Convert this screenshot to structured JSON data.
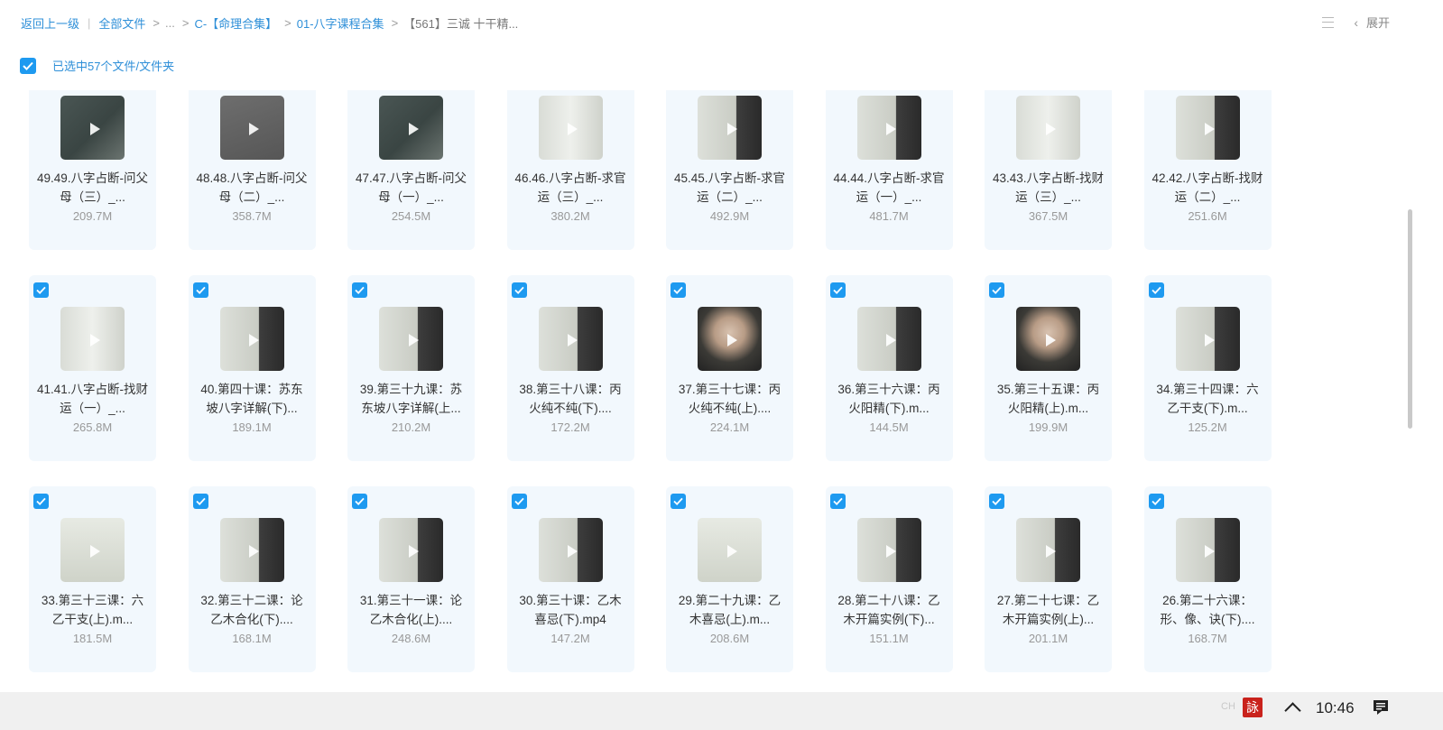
{
  "breadcrumb": {
    "back": "返回上一级",
    "root": "全部文件",
    "ellipsis": "...",
    "level1": "C-【命理合集】",
    "level2": "01-八字课程合集",
    "current": "【561】三诚 十干精..."
  },
  "toolbar": {
    "expand_label": "展开",
    "view_icon": "list-view-icon",
    "collapse_icon": "chevron-left-icon"
  },
  "selection": {
    "label": "已选中57个文件/文件夹",
    "checked": true
  },
  "files": [
    {
      "name": "49.49.八字占断-问父母（三）_...",
      "size": "209.7M",
      "thumb": "chalkboard-hand"
    },
    {
      "name": "48.48.八字占断-问父母（二）_...",
      "size": "358.7M",
      "thumb": "gray"
    },
    {
      "name": "47.47.八字占断-问父母（一）_...",
      "size": "254.5M",
      "thumb": "chalkboard-hand"
    },
    {
      "name": "46.46.八字占断-求官运（三）_...",
      "size": "380.2M",
      "thumb": "whiteboard-grid"
    },
    {
      "name": "45.45.八字占断-求官运（二）_...",
      "size": "492.9M",
      "thumb": "whiteboard-man"
    },
    {
      "name": "44.44.八字占断-求官运（一）_...",
      "size": "481.7M",
      "thumb": "whiteboard-man"
    },
    {
      "name": "43.43.八字占断-找财运（三）_...",
      "size": "367.5M",
      "thumb": "whiteboard-grid"
    },
    {
      "name": "42.42.八字占断-找财运（二）_...",
      "size": "251.6M",
      "thumb": "whiteboard-man"
    },
    {
      "name": "41.41.八字占断-找财运（一）_...",
      "size": "265.8M",
      "thumb": "whiteboard-grid"
    },
    {
      "name": "40.第四十课：苏东坡八字详解(下)...",
      "size": "189.1M",
      "thumb": "whiteboard-man"
    },
    {
      "name": "39.第三十九课：苏东坡八字详解(上...",
      "size": "210.2M",
      "thumb": "whiteboard-man"
    },
    {
      "name": "38.第三十八课：丙火纯不纯(下)....",
      "size": "172.2M",
      "thumb": "whiteboard-man"
    },
    {
      "name": "37.第三十七课：丙火纯不纯(上)....",
      "size": "224.1M",
      "thumb": "face"
    },
    {
      "name": "36.第三十六课：丙火阳精(下).m...",
      "size": "144.5M",
      "thumb": "whiteboard-man"
    },
    {
      "name": "35.第三十五课：丙火阳精(上).m...",
      "size": "199.9M",
      "thumb": "face"
    },
    {
      "name": "34.第三十四课：六乙干支(下).m...",
      "size": "125.2M",
      "thumb": "whiteboard-man"
    },
    {
      "name": "33.第三十三课：六乙干支(上).m...",
      "size": "181.5M",
      "thumb": "whiteboard"
    },
    {
      "name": "32.第三十二课：论乙木合化(下)....",
      "size": "168.1M",
      "thumb": "whiteboard-man"
    },
    {
      "name": "31.第三十一课：论乙木合化(上)....",
      "size": "248.6M",
      "thumb": "whiteboard-man"
    },
    {
      "name": "30.第三十课：乙木喜忌(下).mp4",
      "size": "147.2M",
      "thumb": "whiteboard-man"
    },
    {
      "name": "29.第二十九课：乙木喜忌(上).m...",
      "size": "208.6M",
      "thumb": "whiteboard"
    },
    {
      "name": "28.第二十八课：乙木开篇实例(下)...",
      "size": "151.1M",
      "thumb": "whiteboard-man"
    },
    {
      "name": "27.第二十七课：乙木开篇实例(上)...",
      "size": "201.1M",
      "thumb": "whiteboard-man"
    },
    {
      "name": "26.第二十六课：形、像、诀(下)....",
      "size": "168.7M",
      "thumb": "whiteboard-man"
    }
  ],
  "taskbar": {
    "ime": "CH",
    "seal": "詠",
    "time": "10:46"
  }
}
